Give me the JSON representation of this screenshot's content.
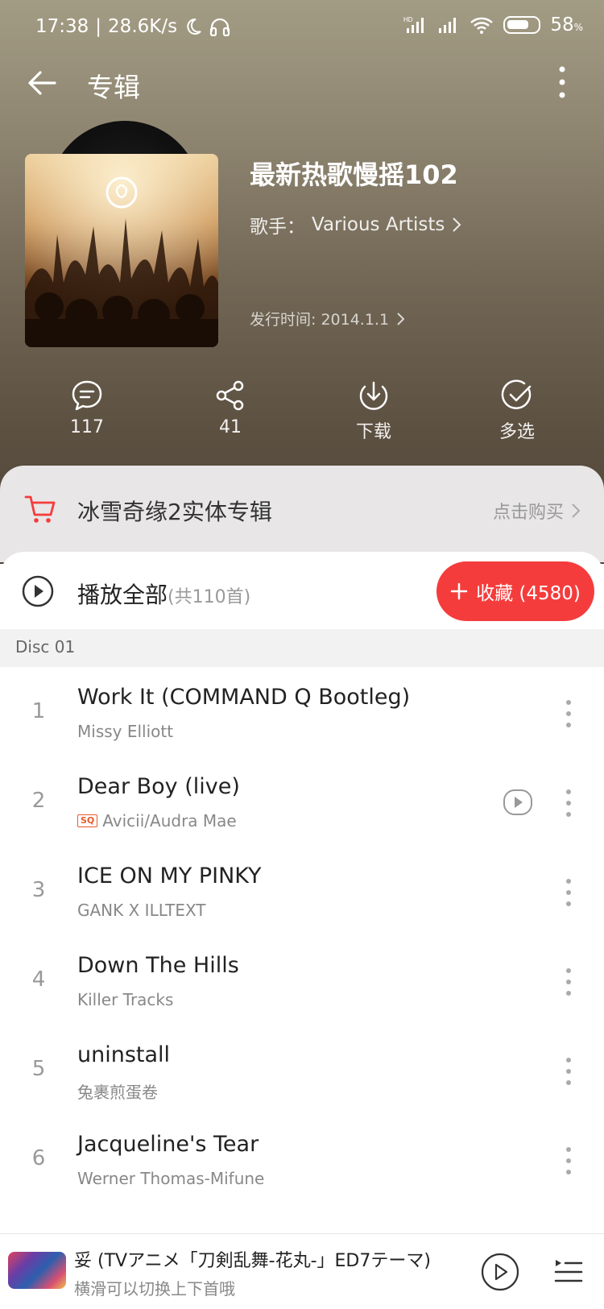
{
  "status_bar": {
    "time": "17:38",
    "network_speed": "28.6K/s",
    "battery": "58",
    "battery_unit": "%"
  },
  "app_bar": {
    "title": "专辑"
  },
  "album": {
    "title": "最新热歌慢摇102",
    "artist_label": "歌手：",
    "artist": "Various Artists",
    "release_label": "发行时间: 2014.1.1"
  },
  "actions": {
    "comment_count": "117",
    "share_count": "41",
    "download_label": "下载",
    "multiselect_label": "多选"
  },
  "promo": {
    "text": "冰雪奇缘2实体专辑",
    "buy_label": "点击购买"
  },
  "play_all": {
    "label": "播放全部",
    "count": "(共110首)",
    "collect_label": "收藏 (4580)"
  },
  "disc": {
    "label": "Disc 01"
  },
  "tracks": [
    {
      "num": "1",
      "title": "Work It (COMMAND Q Bootleg)",
      "artist": "Missy Elliott",
      "sq": false,
      "mv": false
    },
    {
      "num": "2",
      "title": "Dear Boy (live)",
      "artist": "Avicii/Audra Mae",
      "sq": true,
      "mv": true
    },
    {
      "num": "3",
      "title": "ICE ON MY PINKY",
      "artist": "GANK X ILLTEXT",
      "sq": false,
      "mv": false
    },
    {
      "num": "4",
      "title": "Down The Hills",
      "artist": "Killer Tracks",
      "sq": false,
      "mv": false
    },
    {
      "num": "5",
      "title": "uninstall",
      "artist": "兔裹煎蛋卷",
      "sq": false,
      "mv": false
    },
    {
      "num": "6",
      "title": "Jacqueline's Tear",
      "artist": "Werner Thomas-Mifune",
      "sq": false,
      "mv": false
    }
  ],
  "sq_badge": "SQ",
  "player": {
    "title": "妥 (TVアニメ「刀剣乱舞-花丸-」ED7テーマ)",
    "subtitle": "横滑可以切换上下首哦"
  },
  "colors": {
    "accent": "#f53c3c",
    "sq_badge": "#e85a2a"
  }
}
